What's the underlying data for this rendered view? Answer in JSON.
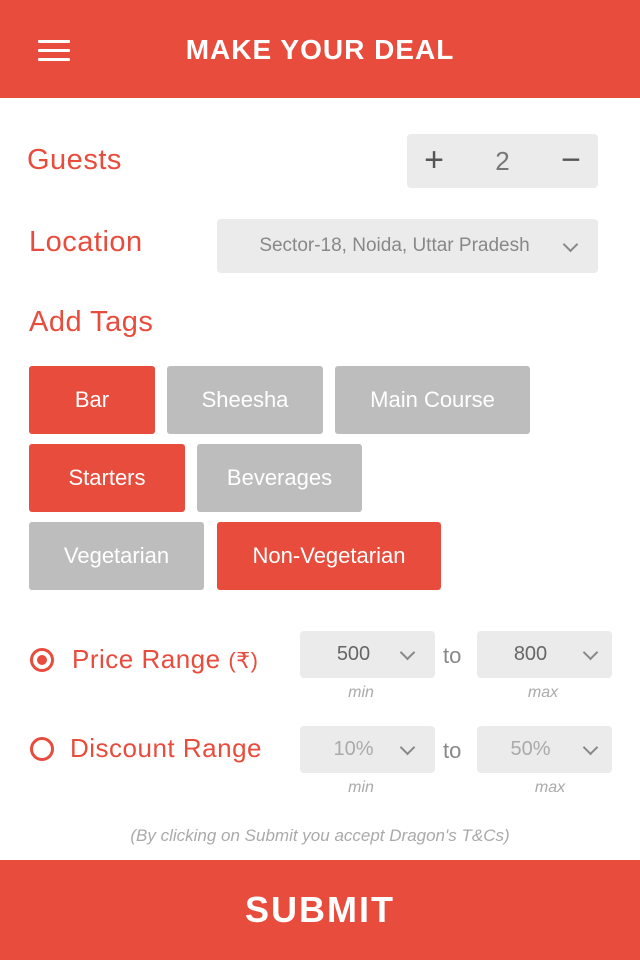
{
  "header": {
    "title": "MAKE YOUR DEAL",
    "menu_icon": "hamburger-menu-icon"
  },
  "guests": {
    "label": "Guests",
    "value": "2",
    "increment_symbol": "+",
    "decrement_symbol": "−"
  },
  "location": {
    "label": "Location",
    "value": "Sector-18, Noida, Uttar Pradesh"
  },
  "tags": {
    "label": "Add Tags",
    "items": [
      {
        "label": "Bar",
        "selected": true
      },
      {
        "label": "Sheesha",
        "selected": false
      },
      {
        "label": "Main Course",
        "selected": false
      },
      {
        "label": "Starters",
        "selected": true
      },
      {
        "label": "Beverages",
        "selected": false
      },
      {
        "label": "Vegetarian",
        "selected": false
      },
      {
        "label": "Non-Vegetarian",
        "selected": true
      }
    ]
  },
  "price_range": {
    "label": "Price Range",
    "currency": "(₹)",
    "selected": true,
    "min": "500",
    "max": "800",
    "to_label": "to",
    "min_hint": "min",
    "max_hint": "max"
  },
  "discount_range": {
    "label": "Discount Range",
    "selected": false,
    "min": "10%",
    "max": "50%",
    "to_label": "to",
    "min_hint": "min",
    "max_hint": "max"
  },
  "terms": "(By clicking on Submit you accept Dragon's T&Cs)",
  "submit_label": "SUBMIT",
  "colors": {
    "accent": "#e84c3d",
    "tag_off": "#bdbdbd",
    "field_bg": "#ebebeb"
  }
}
